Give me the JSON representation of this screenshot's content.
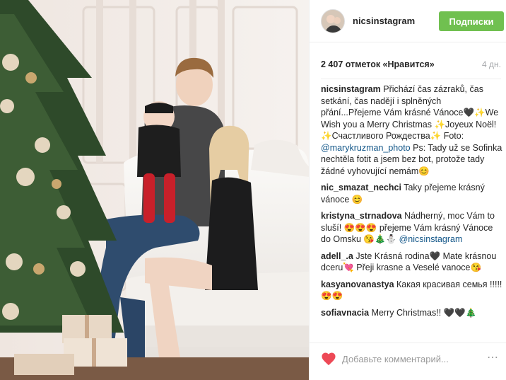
{
  "post": {
    "username": "nicsinstagram",
    "follow_label": "Подписки",
    "likes": "2 407 отметок «Нравится»",
    "time": "4 дн."
  },
  "comments": [
    {
      "user": "nicsinstagram",
      "text_a": " Přichází čas zázraků, čas setkání, čas nadějí i splněných přání...Přejeme Vám krásné Vánoce🖤✨We Wish you a Merry Christmas ✨Joyeux Noël! ✨Счастливого Рождества✨ Foto: ",
      "mention": "@marykruzman_photo",
      "text_b": " Ps: Tady už se Sofinka nechtěla fotit a jsem bez bot, protože tady žádné vyhovující nemám😊"
    },
    {
      "user": "nic_smazat_nechci",
      "text_a": " Taky přejeme krásný vánoce 😊",
      "mention": "",
      "text_b": ""
    },
    {
      "user": "kristyna_strnadova",
      "text_a": " Nádherný, moc Vám to sluší! 😍😍😍 přejeme Vám krásný Vánoce do Omsku 😘🎄⛄ ",
      "mention": "@nicsinstagram",
      "text_b": ""
    },
    {
      "user": "adell_.a",
      "text_a": " Jste Krásná rodina🖤 Mate krásnou dceru💘 Přeji krasne a Veselé vanoce😘",
      "mention": "",
      "text_b": ""
    },
    {
      "user": "kasyanovanastya",
      "text_a": " Какая красивая семья !!!!!😍😍",
      "mention": "",
      "text_b": ""
    },
    {
      "user": "sofiavnacia",
      "text_a": " Merry Christmas!! 🖤🖤🎄",
      "mention": "",
      "text_b": ""
    }
  ],
  "input": {
    "placeholder": "Добавьте комментарий..."
  },
  "icons": {
    "heart": "heart-icon",
    "more": "more-options-icon"
  },
  "colors": {
    "follow": "#70c050",
    "heart": "#ed4956",
    "mention": "#125688"
  }
}
